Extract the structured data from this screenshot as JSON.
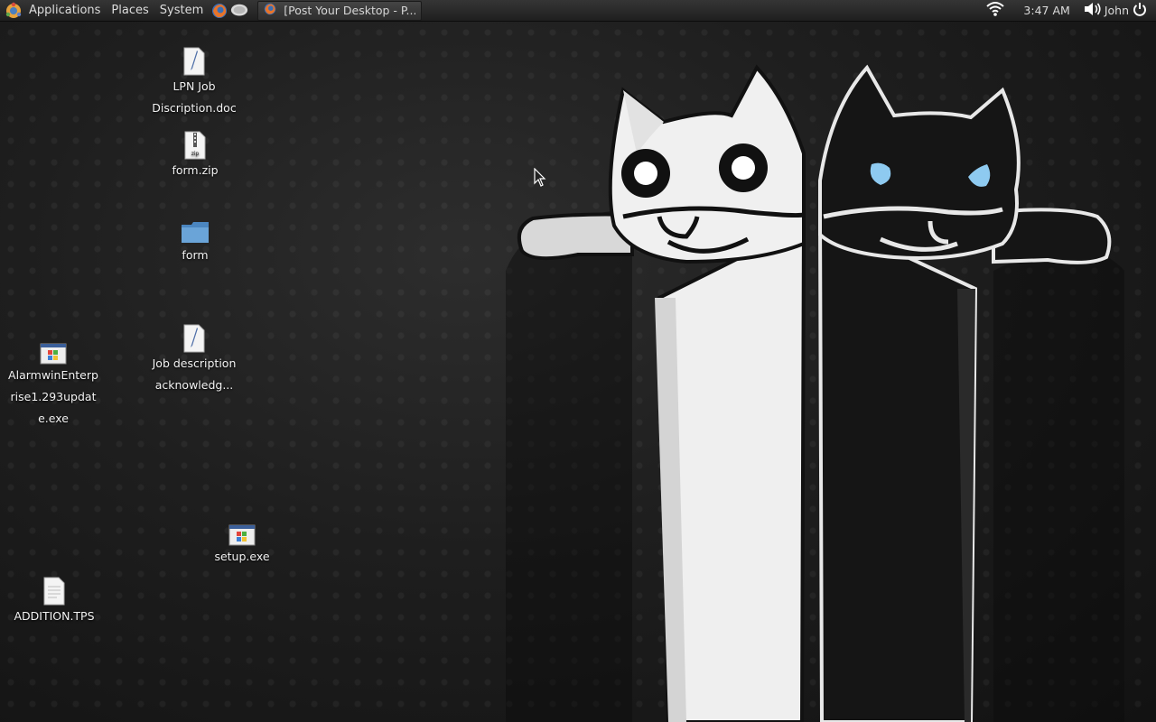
{
  "top_panel": {
    "menus": [
      "Applications",
      "Places",
      "System"
    ],
    "taskbar_window_title": "[Post Your Desktop - P...",
    "clock": "3:47 AM",
    "user": "John"
  },
  "desktop_icons": [
    {
      "label": "LPN Job Discription.doc",
      "icon": "document-icon"
    },
    {
      "label": "form.zip",
      "icon": "zip-archive-icon"
    },
    {
      "label": "form",
      "icon": "folder-icon"
    },
    {
      "label": "AlarmwinEnterprise1.293update.exe",
      "icon": "windows-exe-icon"
    },
    {
      "label": "Job description acknowledg...",
      "icon": "document-icon"
    },
    {
      "label": "setup.exe",
      "icon": "windows-exe-icon"
    },
    {
      "label": "ADDITION.TPS",
      "icon": "text-file-icon"
    }
  ],
  "wallpaper": {
    "subject": "longcat-and-tacgnol-icon"
  },
  "colors": {
    "panel": "#2a2a2a",
    "background": "#1b1b1b",
    "white_cat": "#f0f0f0",
    "black_cat": "#141414",
    "eye_blue": "#8ecaf0"
  }
}
